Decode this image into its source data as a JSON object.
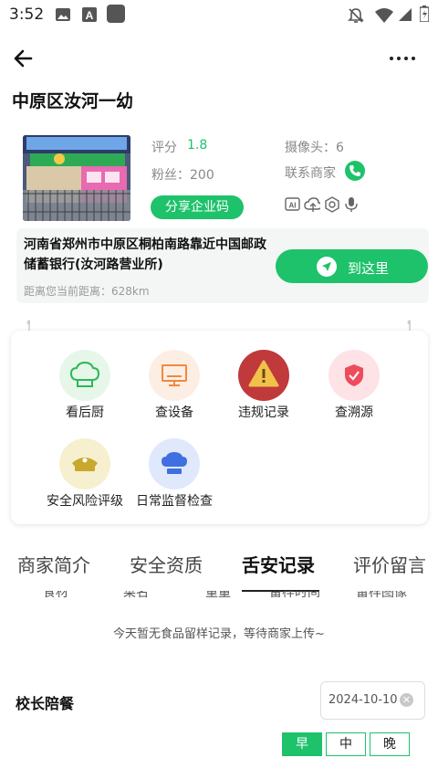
{
  "status_bar": {
    "time": "3:52"
  },
  "header": {
    "title": "中原区汝河一幼"
  },
  "merchant": {
    "rating_label": "评分",
    "rating_value": "1.8",
    "fans": "粉丝：200",
    "cameras": "摄像头：6",
    "contact": "联系商家",
    "share_button": "分享企业码",
    "address": "河南省郑州市中原区桐柏南路靠近中国邮政储蓄银行(汝河路营业所)",
    "distance": "距离您当前距离：628km",
    "goto_button": "到这里"
  },
  "grid": [
    {
      "label": "看后厨",
      "icon": "chef-hat-icon"
    },
    {
      "label": "查设备",
      "icon": "monitor-icon"
    },
    {
      "label": "违规记录",
      "icon": "warning-icon"
    },
    {
      "label": "查溯源",
      "icon": "shield-check-icon"
    },
    {
      "label": "安全风险评级",
      "icon": "police-cap-icon"
    },
    {
      "label": "日常监督检查",
      "icon": "chef-hat-blue-icon"
    }
  ],
  "tabs": [
    "商家简介",
    "安全资质",
    "舌安记录",
    "评价留言"
  ],
  "active_tab": "舌安记录",
  "sample_table": {
    "headers": [
      "食材",
      "菜名",
      "重量",
      "留样时间",
      "留样图像"
    ],
    "empty_message": "今天暂无食品留样记录，等待商家上传~"
  },
  "principal_meal": {
    "title": "校长陪餐",
    "date": "2024-10-10",
    "meals": [
      "早",
      "中",
      "晚"
    ],
    "selected_meal": "早"
  },
  "colors": {
    "accent": "#1ec26a"
  }
}
